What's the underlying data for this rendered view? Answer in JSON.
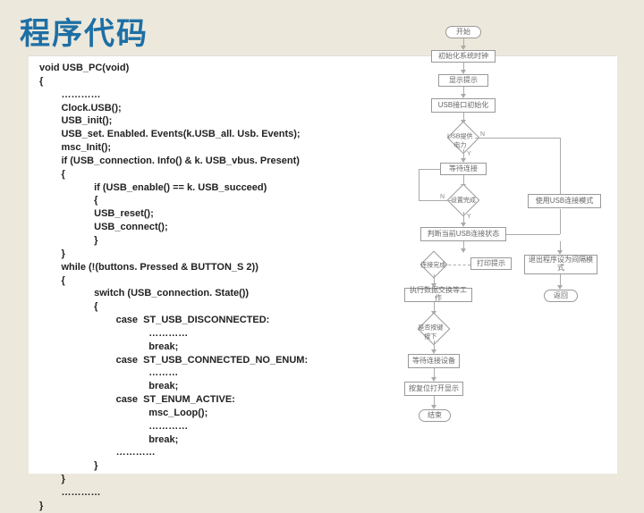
{
  "title": "程序代码",
  "code_lines": [
    "void USB_PC(void)",
    "{",
    "        …………",
    "        Clock.USB();",
    "        USB_init();",
    "        USB_set. Enabled. Events(k.USB_all. Usb. Events);",
    "        msc_Init();",
    "        if (USB_connection. Info() & k. USB_vbus. Present)",
    "        {",
    "                    if (USB_enable() == k. USB_succeed)",
    "                    {",
    "                    USB_reset();",
    "                    USB_connect();",
    "                    }",
    "        }",
    "        while (!(buttons. Pressed & BUTTON_S 2))",
    "        {",
    "                    switch (USB_connection. State())",
    "                    {",
    "                            case  ST_USB_DISCONNECTED:",
    "                                        …………",
    "                                        break;",
    "                            case  ST_USB_CONNECTED_NO_ENUM:",
    "                                        ………",
    "                                        break;",
    "                            case  ST_ENUM_ACTIVE:",
    "                                        msc_Loop();",
    "                                        …………",
    "                                        break;",
    "                            …………",
    "                    }",
    "        }",
    "        …………",
    "}"
  ],
  "flow": {
    "start": "开始",
    "n1": "初始化系统时钟",
    "n2": "显示提示",
    "n3": "USB接口初始化",
    "d1": "USB提供电力",
    "n4": "等待连接",
    "d2": "设置完成",
    "n5": "判断当前USB连接状态",
    "n6": "使用USB连接模式",
    "d3": "连接完成",
    "n7": "打印提示",
    "n8": "退出程序设为间隔模式",
    "n9": "执行数据交换等工作",
    "n10": "返回",
    "d4": "是否按键按下",
    "n11": "等待连接设备",
    "n12": "按复位打开显示",
    "end": "结束",
    "yes": "Y",
    "no": "N"
  }
}
